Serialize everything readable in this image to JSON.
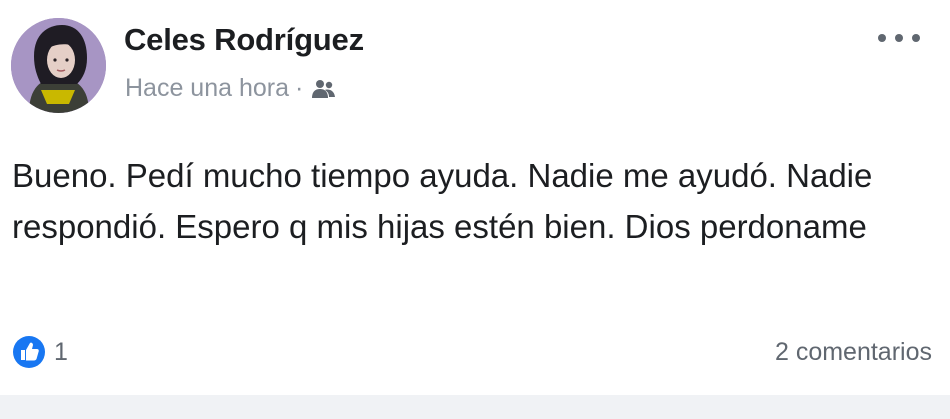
{
  "post": {
    "author_name": "Celes Rodríguez",
    "timestamp": "Hace una hora",
    "separator": "·",
    "audience_icon": "friends-icon",
    "more_icon": "more-options-icon",
    "text": "Bueno. Pedí mucho tiempo ayuda. Nadie me ayudó. Nadie respondió. Espero q mis hijas estén bien. Dios perdoname",
    "reactions_count": "1",
    "reaction_icon": "like-icon",
    "comments_label": "2 comentarios"
  },
  "colors": {
    "name_text": "#1c1e21",
    "meta_text": "#8d949e",
    "like_blue": "#1877f2",
    "background": "#ffffff"
  }
}
